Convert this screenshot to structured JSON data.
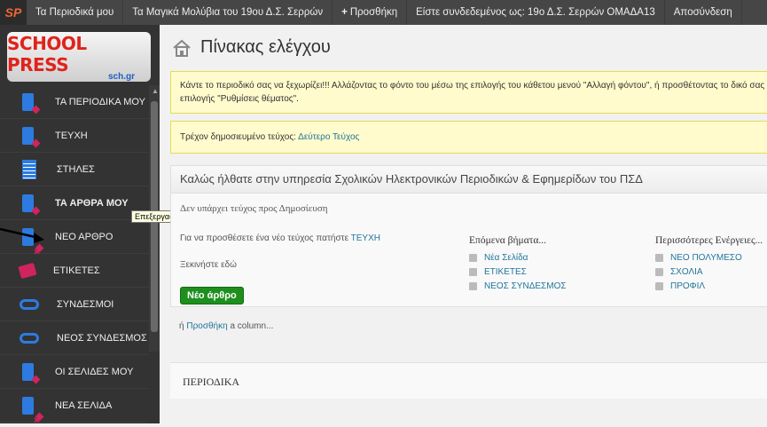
{
  "topbar": {
    "logo": "SP",
    "items": [
      "Τα Περιοδικά μου",
      "Τα Μαγικά Μολύβια του 19ου Δ.Σ. Σερρών",
      "Προσθήκη",
      "Είστε συνδεδεμένος ως: 19ο Δ.Σ. Σερρών ΟΜΑΔΑ13",
      "Αποσύνδεση"
    ],
    "plus": "+"
  },
  "logo": {
    "line1": "SCHOOL PRESS",
    "line2": "sch.gr"
  },
  "menu": [
    {
      "label": "ΤΑ ΠΕΡΙΟΔΙΚΑ ΜΟΥ",
      "icon": "doc-icon"
    },
    {
      "label": "ΤΕΥΧΗ",
      "icon": "doc-icon"
    },
    {
      "label": "ΣΤΗΛΕΣ",
      "icon": "columns-icon"
    },
    {
      "label": "ΤΑ ΑΡΘΡΑ ΜΟΥ",
      "icon": "doc-icon"
    },
    {
      "label": "ΝΕΟ ΑΡΘΡΟ",
      "icon": "doc-plus-icon"
    },
    {
      "label": "ΕΤΙΚΕΤΕΣ",
      "icon": "tag-icon"
    },
    {
      "label": "ΣΥΝΔΕΣΜΟΙ",
      "icon": "link-icon"
    },
    {
      "label": "ΝΕΟΣ ΣΥΝΔΕΣΜΟΣ",
      "icon": "link-plus-icon"
    },
    {
      "label": "ΟΙ ΣΕΛΙΔΕΣ ΜΟΥ",
      "icon": "doc-icon"
    },
    {
      "label": "ΝΕΑ ΣΕΛΙΔΑ",
      "icon": "doc-plus-icon"
    }
  ],
  "tooltip": "Επεξεργασία Άρθρων",
  "main": {
    "title": "Πίνακας ελέγχου",
    "notice1": "Κάντε το περιοδικό σας να ξεχωρίζει!!! Αλλάζοντας το φόντο του μέσω της επιλογής του κάθετου μενού \"Αλλαγή φόντου\", ή προσθέτοντας το δικό σας",
    "notice1b": "επιλογής \"Ρυθμίσεις θέματος\".",
    "notice2_text": "Τρέχον δημοσιευμένο τεύχος:",
    "notice2_link": "Δεύτερο Τεύχος",
    "welcome": "Καλώς ήλθατε στην υπηρεσία Σχολικών Ηλεκτρονικών Περιοδικών & Εφημερίδων του ΠΣΔ",
    "no_issue": "Δεν υπάρχει τεύχος προς Δημοσίευση",
    "add_issue_text": "Για να προσθέσετε ένα νέο τεύχος πατήστε",
    "add_issue_link": "ΤΕΥΧΗ",
    "start_here": "Ξεκινήστε εδώ",
    "new_article_btn": "Νέο άρθρο",
    "or_text": "ή",
    "add_link": "Προσθήκη",
    "column_text": "a column...",
    "next_steps": {
      "title": "Επόμενα βήματα...",
      "items": [
        "Νέα Σελίδα",
        "ΕΤΙΚΕΤΕΣ",
        "ΝΕΟΣ ΣΥΝΔΕΣΜΟΣ"
      ]
    },
    "more_actions": {
      "title": "Περισσότερες Ενέργειες...",
      "items": [
        "ΝΕΟ ΠΟΛΥΜΕΣΟ",
        "ΣΧΟΛΙΑ",
        "ΠΡΟΦΙΛ"
      ]
    },
    "section2": "ΠΕΡΙΟΔΙΚΑ"
  },
  "colors": {
    "topbar": "#464646",
    "sidebar": "#333333",
    "notice_bg": "#fffbcc",
    "link": "#21759b",
    "button": "#1e8f1e"
  }
}
